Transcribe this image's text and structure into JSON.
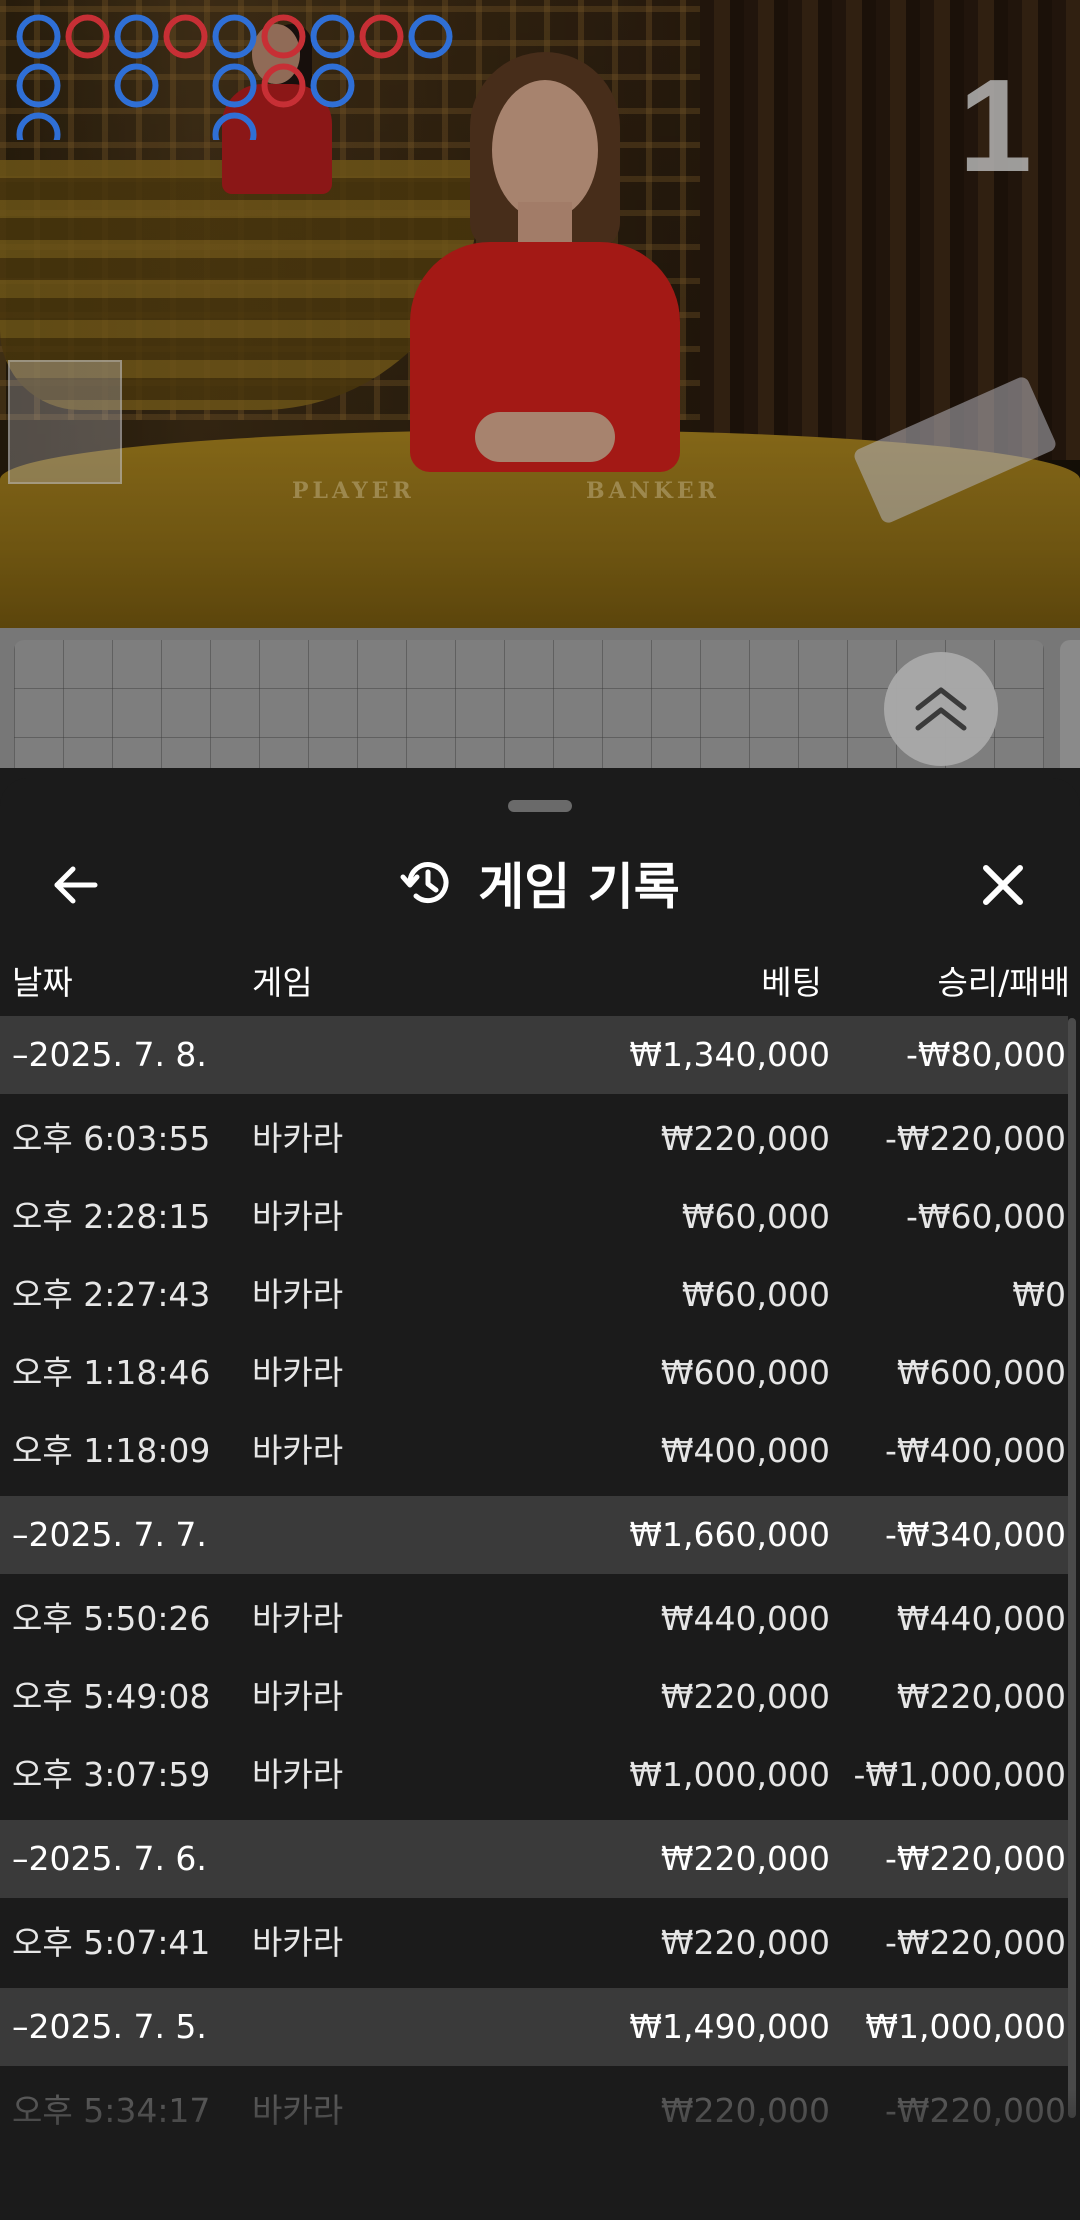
{
  "video": {
    "round_number": "1",
    "felt_player": "PLAYER",
    "felt_banker": "BANKER"
  },
  "bead_road": {
    "colors": {
      "player": "#2f6fd6",
      "banker": "#c72f35"
    },
    "beads": [
      {
        "col": 0,
        "row": 0,
        "c": "player"
      },
      {
        "col": 1,
        "row": 0,
        "c": "banker"
      },
      {
        "col": 2,
        "row": 0,
        "c": "player"
      },
      {
        "col": 3,
        "row": 0,
        "c": "banker"
      },
      {
        "col": 4,
        "row": 0,
        "c": "player"
      },
      {
        "col": 5,
        "row": 0,
        "c": "banker"
      },
      {
        "col": 6,
        "row": 0,
        "c": "player"
      },
      {
        "col": 7,
        "row": 0,
        "c": "banker"
      },
      {
        "col": 8,
        "row": 0,
        "c": "player"
      },
      {
        "col": 0,
        "row": 1,
        "c": "player"
      },
      {
        "col": 2,
        "row": 1,
        "c": "player"
      },
      {
        "col": 4,
        "row": 1,
        "c": "player"
      },
      {
        "col": 5,
        "row": 1,
        "c": "banker"
      },
      {
        "col": 6,
        "row": 1,
        "c": "player"
      },
      {
        "col": 0,
        "row": 2,
        "c": "player"
      },
      {
        "col": 4,
        "row": 2,
        "c": "player"
      }
    ]
  },
  "sheet": {
    "title": "게임 기록",
    "title_icon": "history-icon",
    "back_icon": "arrow-left-icon",
    "close_icon": "close-icon",
    "columns": {
      "date": "날짜",
      "game": "게임",
      "bet": "베팅",
      "win_loss": "승리/패배"
    },
    "groups": [
      {
        "date": "–2025. 7. 8.",
        "bet": "₩1,340,000",
        "win": "-₩80,000",
        "rows": [
          {
            "time": "오후 6:03:55",
            "game": "바카라",
            "bet": "₩220,000",
            "win": "-₩220,000"
          },
          {
            "time": "오후 2:28:15",
            "game": "바카라",
            "bet": "₩60,000",
            "win": "-₩60,000"
          },
          {
            "time": "오후 2:27:43",
            "game": "바카라",
            "bet": "₩60,000",
            "win": "₩0"
          },
          {
            "time": "오후 1:18:46",
            "game": "바카라",
            "bet": "₩600,000",
            "win": "₩600,000"
          },
          {
            "time": "오후 1:18:09",
            "game": "바카라",
            "bet": "₩400,000",
            "win": "-₩400,000"
          }
        ]
      },
      {
        "date": "–2025. 7. 7.",
        "bet": "₩1,660,000",
        "win": "-₩340,000",
        "rows": [
          {
            "time": "오후 5:50:26",
            "game": "바카라",
            "bet": "₩440,000",
            "win": "₩440,000"
          },
          {
            "time": "오후 5:49:08",
            "game": "바카라",
            "bet": "₩220,000",
            "win": "₩220,000"
          },
          {
            "time": "오후 3:07:59",
            "game": "바카라",
            "bet": "₩1,000,000",
            "win": "-₩1,000,000"
          }
        ]
      },
      {
        "date": "–2025. 7. 6.",
        "bet": "₩220,000",
        "win": "-₩220,000",
        "rows": [
          {
            "time": "오후 5:07:41",
            "game": "바카라",
            "bet": "₩220,000",
            "win": "-₩220,000"
          }
        ]
      },
      {
        "date": "–2025. 7. 5.",
        "bet": "₩1,490,000",
        "win": "₩1,000,000",
        "rows": [
          {
            "time": "오후 5:34:17",
            "game": "바카라",
            "bet": "₩220,000",
            "win": "-₩220,000"
          }
        ]
      }
    ]
  }
}
